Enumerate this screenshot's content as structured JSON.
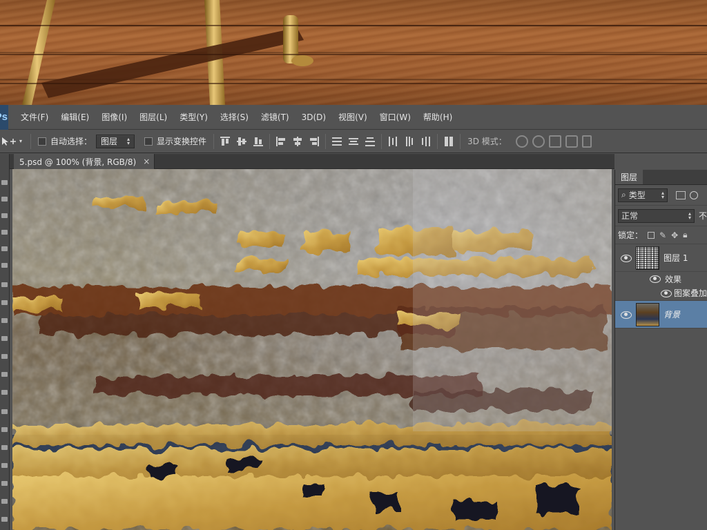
{
  "menu": {
    "logo": "Ps",
    "items": [
      "文件(F)",
      "编辑(E)",
      "图像(I)",
      "图层(L)",
      "类型(Y)",
      "选择(S)",
      "滤镜(T)",
      "3D(D)",
      "视图(V)",
      "窗口(W)",
      "帮助(H)"
    ]
  },
  "options": {
    "auto_select_label": "自动选择：",
    "auto_select_value": "图层",
    "show_transform_label": "显示变换控件",
    "mode3d_label": "3D 模式："
  },
  "document": {
    "tab_title": "5.psd @ 100% (背景, RGB/8)",
    "close_glyph": "×"
  },
  "layers_panel": {
    "tab_label": "图层",
    "filter_label": "类型",
    "blend_mode": "正常",
    "opacity_fragment": "不",
    "lock_label": "锁定：",
    "layers": [
      {
        "name": "图层 1",
        "selected": false,
        "effects_label": "效果",
        "effect_item": "图案叠加"
      },
      {
        "name": "背景",
        "selected": true
      }
    ]
  },
  "colors": {
    "ui_bg": "#535353",
    "selected_layer": "#5b7fa5",
    "gold": "#c9a04a",
    "rust": "#5a2a14"
  }
}
